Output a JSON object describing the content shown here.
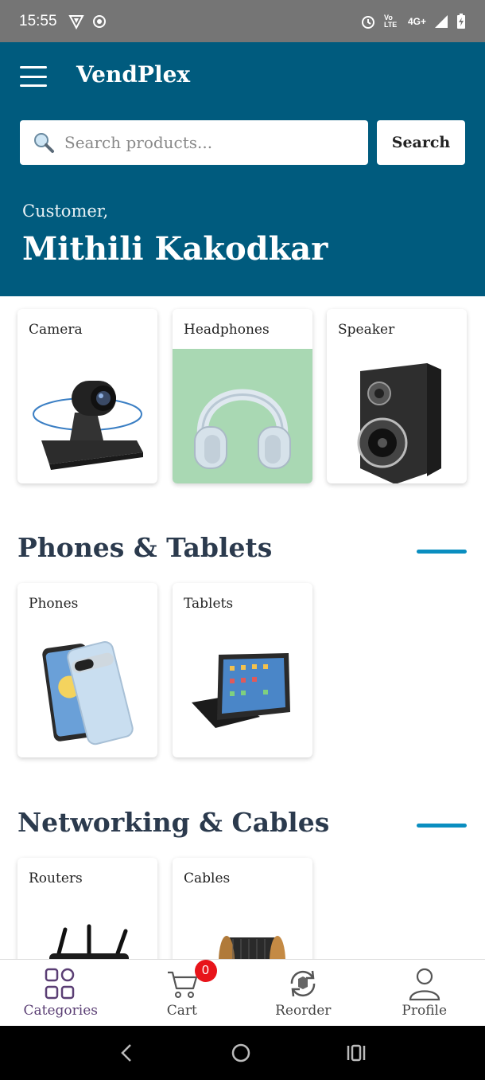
{
  "status_bar": {
    "time": "15:55",
    "network": "4G+",
    "volte": "Vo LTE"
  },
  "header": {
    "brand": "VendPlex",
    "search_placeholder": "Search products...",
    "search_button": "Search",
    "greeting": "Customer,",
    "customer_name": "Mithili Kakodkar"
  },
  "featured": [
    {
      "label": "Camera"
    },
    {
      "label": "Headphones"
    },
    {
      "label": "Speaker"
    }
  ],
  "sections": [
    {
      "title": "Phones & Tablets",
      "items": [
        {
          "label": "Phones"
        },
        {
          "label": "Tablets"
        }
      ]
    },
    {
      "title": "Networking & Cables",
      "items": [
        {
          "label": "Routers"
        },
        {
          "label": "Cables"
        }
      ]
    }
  ],
  "bottom_nav": {
    "categories": "Categories",
    "cart": "Cart",
    "cart_count": "0",
    "reorder": "Reorder",
    "profile": "Profile"
  },
  "colors": {
    "header_bg": "#005b7e",
    "accent": "#0a8ec0",
    "badge": "#e8141a",
    "active_nav": "#5a3e74"
  }
}
